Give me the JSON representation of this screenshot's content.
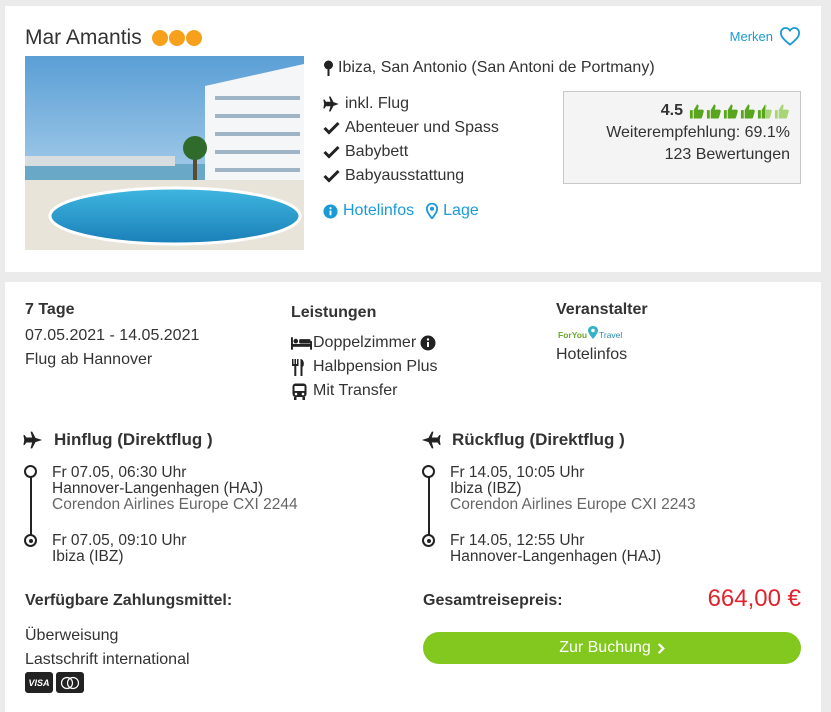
{
  "hotel": {
    "name": "Mar Amantis",
    "stars": 3,
    "merken_label": "Merken",
    "location": "Ibiza, San Antonio (San Antoni de Portmany)",
    "features": [
      {
        "icon": "plane-icon",
        "label": "inkl. Flug"
      },
      {
        "icon": "check-icon",
        "label": "Abenteuer und Spass"
      },
      {
        "icon": "check-icon",
        "label": "Babybett"
      },
      {
        "icon": "check-icon",
        "label": "Babyausstattung"
      }
    ],
    "links": {
      "hotelinfos": "Hotelinfos",
      "lage": "Lage"
    },
    "rating": {
      "score": "4.5",
      "thumbs_filled": 4.5,
      "thumbs_total": 6,
      "recommendation": "Weiterempfehlung: 69.1%",
      "reviews": "123 Bewertungen"
    }
  },
  "offer": {
    "duration": "7 Tage",
    "dates": "07.05.2021 - 14.05.2021",
    "departure": "Flug ab Hannover",
    "services_title": "Leistungen",
    "services": [
      {
        "icon": "bed-icon",
        "label": "Doppelzimmer"
      },
      {
        "icon": "cutlery-icon",
        "label": "Halbpension Plus"
      },
      {
        "icon": "bus-icon",
        "label": "Mit Transfer"
      }
    ],
    "operator_title": "Veranstalter",
    "operator_logo_text": "ForYou Travel",
    "operator_link": "Hotelinfos"
  },
  "outbound": {
    "title": "Hinflug (Direktflug )",
    "dep_time": "Fr 07.05, 06:30 Uhr",
    "dep_airport": "Hannover-Langenhagen (HAJ)",
    "airline": "Corendon Airlines Europe CXI 2244",
    "arr_time": "Fr 07.05, 09:10 Uhr",
    "arr_airport": "Ibiza (IBZ)"
  },
  "return": {
    "title": "Rückflug (Direktflug )",
    "dep_time": "Fr 14.05, 10:05 Uhr",
    "dep_airport": "Ibiza (IBZ)",
    "airline": "Corendon Airlines Europe CXI 2243",
    "arr_time": "Fr 14.05, 12:55 Uhr",
    "arr_airport": "Hannover-Langenhagen (HAJ)"
  },
  "payment": {
    "title": "Verfügbare Zahlungsmittel:",
    "methods": [
      "Überweisung",
      "Lastschrift international"
    ],
    "card_logos": [
      "VISA",
      "MasterCard"
    ]
  },
  "total": {
    "label": "Gesamtreisepreis:",
    "price": "664,00 €",
    "button": "Zur Buchung"
  },
  "colors": {
    "accent_blue": "#1a9ad6",
    "star_orange": "#f7a01c",
    "thumb_green": "#5aa51e",
    "price_red": "#e0232c",
    "button_green": "#82c81e"
  }
}
